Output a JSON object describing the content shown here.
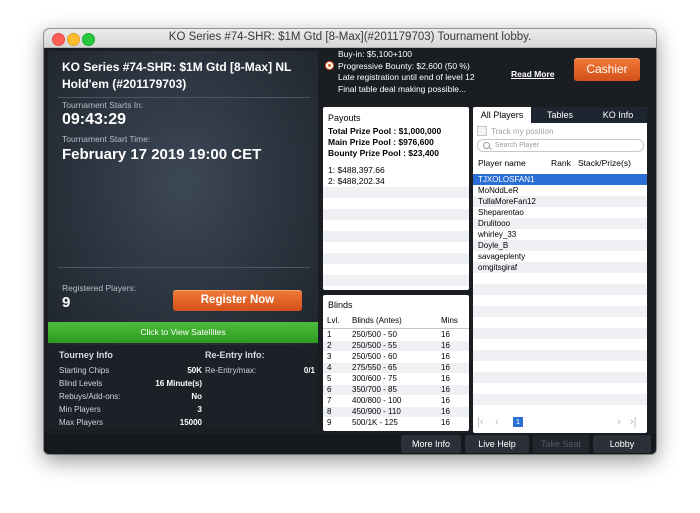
{
  "window": {
    "title": "KO Series #74-SHR: $1M Gtd [8-Max](#201179703) Tournament lobby."
  },
  "tournament": {
    "name": "KO Series #74-SHR: $1M Gtd [8-Max] NL Hold'em (#201179703)",
    "starts_in_label": "Tournament Starts In:",
    "starts_in": "09:43:29",
    "start_time_label": "Tournament Start Time:",
    "start_time": "February 17 2019 19:00 CET",
    "registered_label": "Registered Players:",
    "registered": "9",
    "register_button": "Register Now",
    "satellites_button": "Click to View Satellites"
  },
  "tourney_info": {
    "title": "Tourney Info",
    "rows": [
      {
        "label": "Starting Chips",
        "value": "50K"
      },
      {
        "label": "Blind Levels",
        "value": "16 Minute(s)"
      },
      {
        "label": "Rebuys/Add-ons:",
        "value": "No"
      },
      {
        "label": "Min Players",
        "value": "3"
      },
      {
        "label": "Max Players",
        "value": "15000"
      }
    ],
    "reentry_title": "Re-Entry Info:",
    "reentry": {
      "label": "Re-Entry/max:",
      "value": "0/1"
    }
  },
  "info_lines": {
    "buyin": "Buy-in: $5,100+100",
    "bounty": "Progressive Bounty: $2,600 (50 %)",
    "late_reg": "Late registration until end of level 12",
    "final_table": "Final table deal making possible...",
    "read_more": "Read More",
    "cashier": "Cashier"
  },
  "payouts": {
    "title": "Payouts",
    "total": "Total Prize Pool : $1,000,000",
    "main": "Main Prize Pool : $976,600",
    "bounty": "Bounty Prize Pool : $23,400",
    "rows": [
      "1: $488,397.66",
      "2: $488,202.34"
    ]
  },
  "blinds": {
    "title": "Blinds",
    "headers": {
      "lvl": "Lvl.",
      "blinds": "Blinds (Antes)",
      "mins": "Mins"
    },
    "rows": [
      {
        "lvl": "1",
        "blinds": "250/500 - 50",
        "mins": "16"
      },
      {
        "lvl": "2",
        "blinds": "250/500 - 55",
        "mins": "16"
      },
      {
        "lvl": "3",
        "blinds": "250/500 - 60",
        "mins": "16"
      },
      {
        "lvl": "4",
        "blinds": "275/550 - 65",
        "mins": "16"
      },
      {
        "lvl": "5",
        "blinds": "300/600 - 75",
        "mins": "16"
      },
      {
        "lvl": "6",
        "blinds": "350/700 - 85",
        "mins": "16"
      },
      {
        "lvl": "7",
        "blinds": "400/800 - 100",
        "mins": "16"
      },
      {
        "lvl": "8",
        "blinds": "450/900 - 110",
        "mins": "16"
      },
      {
        "lvl": "9",
        "blinds": "500/1K - 125",
        "mins": "16"
      }
    ]
  },
  "players_panel": {
    "tabs": [
      "All Players",
      "Tables",
      "KO Info"
    ],
    "track_label": "Track my position",
    "search_placeholder": "Search Player",
    "headers": {
      "name": "Player name",
      "rank": "Rank",
      "stack": "Stack/Prize(s)"
    },
    "players": [
      "TJXOLOSFAN1",
      "MoNddLeR",
      "TullaMoreFan12",
      "Sheparentao",
      "Drulitooo",
      "whirley_33",
      "Doyle_B",
      "savageplenty",
      "omgitsgiraf"
    ],
    "page": "1"
  },
  "bottom_buttons": [
    "More Info",
    "Live Help",
    "Take Seat",
    "Lobby"
  ],
  "colors": {
    "accent_orange": "#e8641f",
    "satellite_green": "#3aaa2a",
    "selection_blue": "#2a6fd6"
  }
}
